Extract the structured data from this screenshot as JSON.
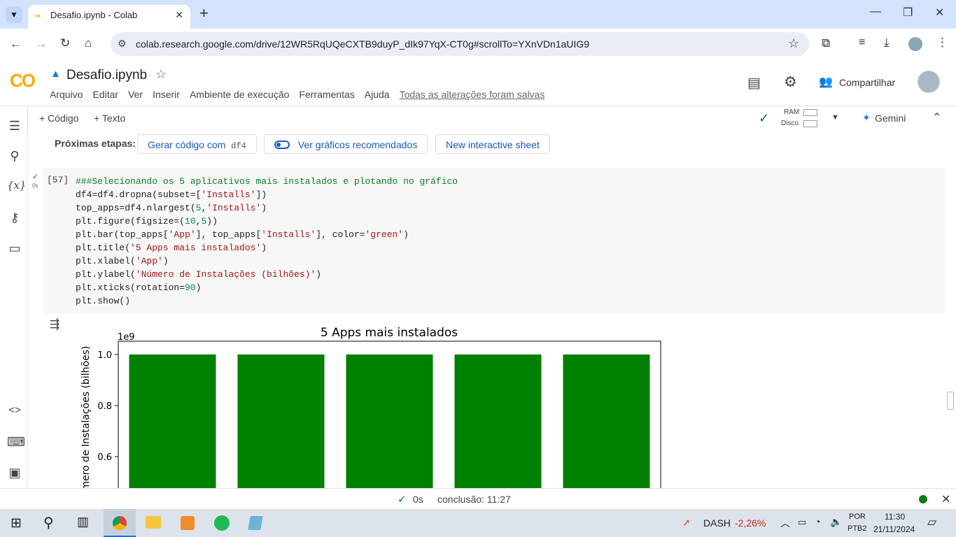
{
  "browser": {
    "tab_title": "Desafio.ipynb - Colab",
    "new_tab": "+",
    "url": "colab.research.google.com/drive/12WR5RqUQeCXTB9duyP_dIk97YqX-CT0g#scrollTo=YXnVDn1aUIG9"
  },
  "colab": {
    "logo": "CO",
    "notebook_title": "Desafio.ipynb",
    "menu": [
      "Arquivo",
      "Editar",
      "Ver",
      "Inserir",
      "Ambiente de execução",
      "Ferramentas",
      "Ajuda"
    ],
    "save_status": "Todas as alterações foram salvas",
    "share_label": "Compartilhar"
  },
  "toolbar": {
    "add_code": "+ Código",
    "add_text": "+ Texto",
    "ram_label": "RAM",
    "disk_label": "Disco",
    "gemini_label": "Gemini"
  },
  "next_steps": {
    "label": "Próximas etapas:",
    "gen_code": "Gerar código com",
    "gen_code_var": "df4",
    "recommended": "Ver gráficos recomendados",
    "sheet": "New interactive sheet"
  },
  "cell": {
    "exec_count": "[57]",
    "exec_time": "0s"
  },
  "chart_data": {
    "type": "bar",
    "title": "5 Apps mais instalados",
    "ylabel": "Número de Instalações (bilhões)",
    "y_offset_label": "1e9",
    "yticks": [
      "1.0",
      "0.8",
      "0.6"
    ],
    "ylim": [
      0.5,
      1.05
    ],
    "values": [
      1.0,
      1.0,
      1.0,
      1.0,
      1.0
    ],
    "color": "#008000"
  },
  "statusbar": {
    "time": "0s",
    "conclusion": "conclusão: 11:27"
  },
  "taskbar": {
    "ticker": "DASH",
    "ticker_change": "-2,26%",
    "lang1": "POR",
    "lang2": "PTB2",
    "clock_time": "11:30",
    "clock_date": "21/11/2024"
  }
}
